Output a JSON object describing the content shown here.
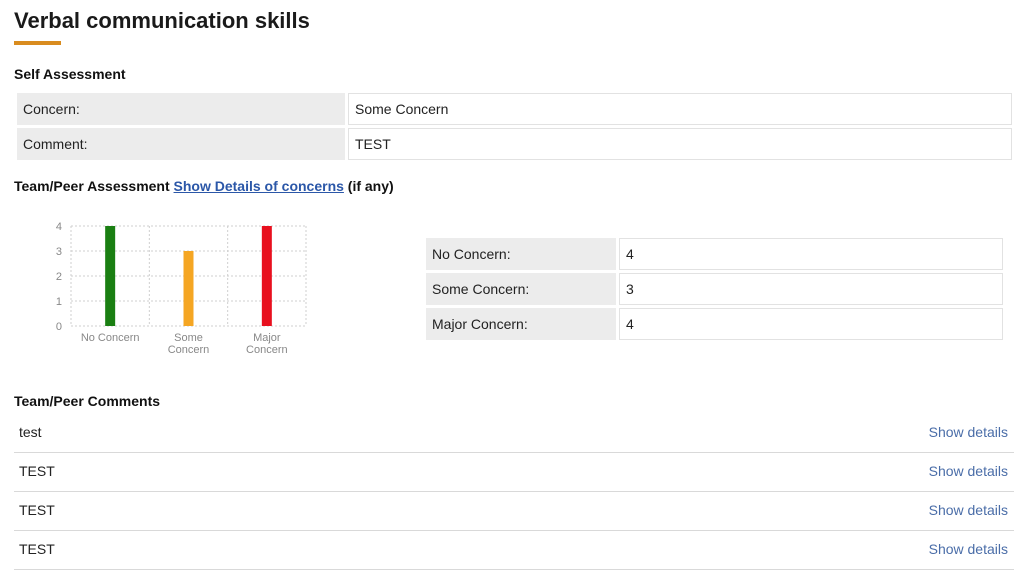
{
  "page": {
    "title": "Verbal communication skills",
    "accent_color": "#d98c1f"
  },
  "self_assessment": {
    "heading": "Self Assessment",
    "rows": [
      {
        "label": "Concern:",
        "value": "Some Concern"
      },
      {
        "label": "Comment:",
        "value": "TEST"
      }
    ]
  },
  "team_assessment": {
    "heading": "Team/Peer Assessment",
    "link_label": "Show Details of concerns",
    "suffix": "(if any)",
    "rows": [
      {
        "label": "No Concern:",
        "value": "4"
      },
      {
        "label": "Some Concern:",
        "value": "3"
      },
      {
        "label": "Major Concern:",
        "value": "4"
      }
    ]
  },
  "chart_data": {
    "type": "bar",
    "categories": [
      "No Concern",
      "Some Concern",
      "Major Concern"
    ],
    "category_label_lines": [
      [
        "No Concern"
      ],
      [
        "Some",
        "Concern"
      ],
      [
        "Major",
        "Concern"
      ]
    ],
    "values": [
      4,
      3,
      4
    ],
    "colors": [
      "#1a7f12",
      "#f5a623",
      "#e8101e"
    ],
    "yticks": [
      "0",
      "1",
      "2",
      "3",
      "4"
    ],
    "ylim": [
      0,
      4
    ],
    "grid": true
  },
  "comments": {
    "heading": "Team/Peer Comments",
    "link_label": "Show details",
    "items": [
      "test",
      "TEST",
      "TEST",
      "TEST"
    ]
  }
}
